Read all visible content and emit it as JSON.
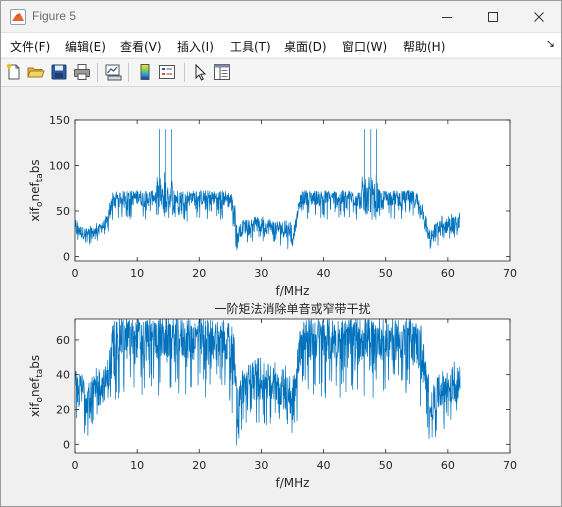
{
  "window": {
    "title": "Figure 5",
    "controls": {
      "minimize": "minimize",
      "maximize": "maximize",
      "close": "close"
    }
  },
  "menu": [
    "文件(F)",
    "编辑(E)",
    "查看(V)",
    "插入(I)",
    "工具(T)",
    "桌面(D)",
    "窗口(W)",
    "帮助(H)"
  ],
  "menu_overflow": "↘",
  "toolbar": [
    "new-figure-icon",
    "open-folder-icon",
    "save-icon",
    "print-icon",
    "link-plot-icon",
    "colorbar-icon",
    "legend-icon",
    "pointer-icon",
    "property-inspector-icon"
  ],
  "colors": {
    "trace": "#0072bd",
    "axes_bg": "#ffffff",
    "figure_bg": "#f0f0f0"
  },
  "chart_data": [
    {
      "type": "line",
      "title": "",
      "xlabel": "f/MHz",
      "ylabel_parts": [
        "xif",
        "o",
        "ne",
        "f",
        "t",
        "a",
        "bs"
      ],
      "xlim": [
        0,
        70
      ],
      "ylim": [
        -5,
        150
      ],
      "xticks": [
        "0",
        "10",
        "20",
        "30",
        "40",
        "50",
        "60",
        "70"
      ],
      "yticks": [
        "0",
        "50",
        "100",
        "150"
      ],
      "xtick_values": [
        0,
        10,
        20,
        30,
        40,
        50,
        60,
        70
      ],
      "ytick_values": [
        0,
        50,
        100,
        150
      ],
      "grid": false,
      "series": [
        {
          "x": [
            0,
            1,
            2,
            3,
            4,
            5,
            5.5,
            6,
            7,
            8,
            9,
            10,
            11,
            12,
            13,
            13.6,
            14,
            14.6,
            15,
            15.5,
            16,
            17,
            18,
            19,
            20,
            21,
            22,
            23,
            24,
            25,
            25.7,
            26.1,
            26.5,
            27,
            28,
            29,
            30,
            31,
            32,
            33,
            34,
            35,
            35.6,
            36,
            36.5,
            37,
            38,
            39,
            40,
            41,
            42,
            43,
            44,
            45,
            46,
            46.6,
            47,
            47.6,
            48,
            48.5,
            49,
            50,
            51,
            52,
            53,
            54,
            55,
            56,
            56.7,
            57.2,
            58,
            59,
            60,
            61,
            62
          ],
          "y_max": [
            42,
            38,
            35,
            36,
            40,
            46,
            58,
            72,
            73,
            72,
            72,
            73,
            72,
            72,
            73,
            140,
            73,
            140,
            73,
            140,
            73,
            72,
            73,
            72,
            72,
            73,
            72,
            72,
            73,
            72,
            62,
            32,
            40,
            45,
            46,
            45,
            46,
            45,
            44,
            44,
            42,
            40,
            45,
            60,
            72,
            73,
            72,
            72,
            73,
            72,
            72,
            73,
            72,
            73,
            73,
            140,
            73,
            140,
            73,
            140,
            72,
            72,
            73,
            72,
            72,
            73,
            72,
            64,
            42,
            30,
            40,
            46,
            47,
            48,
            48
          ],
          "y_min": [
            16,
            12,
            10,
            14,
            18,
            22,
            18,
            35,
            40,
            42,
            40,
            42,
            38,
            40,
            42,
            40,
            42,
            38,
            40,
            42,
            40,
            42,
            38,
            40,
            42,
            40,
            42,
            38,
            40,
            35,
            25,
            -5,
            10,
            14,
            15,
            14,
            15,
            14,
            13,
            12,
            10,
            2,
            22,
            35,
            40,
            42,
            40,
            42,
            38,
            40,
            42,
            40,
            42,
            38,
            40,
            42,
            40,
            42,
            38,
            40,
            42,
            40,
            42,
            38,
            40,
            42,
            35,
            26,
            12,
            4,
            8,
            14,
            16,
            18,
            20
          ],
          "y_mean": [
            30,
            27,
            24,
            26,
            30,
            36,
            42,
            62,
            64,
            65,
            64,
            65,
            64,
            64,
            65,
            65,
            65,
            64,
            65,
            65,
            64,
            65,
            64,
            64,
            65,
            64,
            65,
            64,
            64,
            62,
            50,
            18,
            28,
            32,
            34,
            35,
            34,
            33,
            32,
            31,
            28,
            22,
            36,
            55,
            64,
            65,
            64,
            65,
            64,
            64,
            65,
            64,
            65,
            64,
            64,
            65,
            65,
            64,
            65,
            64,
            64,
            65,
            64,
            64,
            65,
            64,
            62,
            50,
            30,
            20,
            28,
            32,
            34,
            36,
            38
          ]
        }
      ]
    },
    {
      "type": "line",
      "title": "一阶矩法消除单音或窄带干扰",
      "xlabel": "f/MHz",
      "ylabel_parts": [
        "xif",
        "o",
        "ne",
        "f",
        "t",
        "a",
        "bs"
      ],
      "xlim": [
        0,
        70
      ],
      "ylim": [
        -5,
        72
      ],
      "xticks": [
        "0",
        "10",
        "20",
        "30",
        "40",
        "50",
        "60",
        "70"
      ],
      "yticks": [
        "0",
        "20",
        "40",
        "60"
      ],
      "xtick_values": [
        0,
        10,
        20,
        30,
        40,
        50,
        60,
        70
      ],
      "ytick_values": [
        0,
        20,
        40,
        60
      ],
      "grid": false,
      "series": [
        {
          "x": [
            0,
            1,
            2,
            3,
            4,
            5,
            5.5,
            6,
            7,
            8,
            9,
            10,
            11,
            12,
            13,
            14,
            15,
            16,
            17,
            18,
            19,
            20,
            21,
            22,
            23,
            24,
            25,
            25.7,
            26.1,
            26.5,
            27,
            28,
            29,
            30,
            31,
            32,
            33,
            34,
            35,
            35.6,
            36,
            36.5,
            37,
            38,
            39,
            40,
            41,
            42,
            43,
            44,
            45,
            46,
            47,
            48,
            49,
            50,
            51,
            52,
            53,
            54,
            55,
            56,
            56.7,
            57.2,
            58,
            59,
            60,
            61,
            62
          ],
          "y_max": [
            46,
            44,
            42,
            43,
            45,
            50,
            58,
            72,
            72,
            72,
            72,
            72,
            72,
            72,
            72,
            72,
            72,
            72,
            72,
            72,
            72,
            72,
            72,
            72,
            72,
            72,
            72,
            64,
            38,
            42,
            48,
            50,
            51,
            50,
            50,
            49,
            48,
            47,
            44,
            48,
            62,
            72,
            72,
            72,
            72,
            72,
            72,
            72,
            72,
            72,
            72,
            72,
            72,
            72,
            72,
            72,
            72,
            72,
            72,
            72,
            72,
            68,
            46,
            34,
            42,
            46,
            47,
            48,
            48
          ],
          "y_min": [
            10,
            6,
            4,
            6,
            10,
            14,
            8,
            20,
            26,
            28,
            26,
            28,
            25,
            26,
            28,
            26,
            28,
            25,
            26,
            28,
            26,
            28,
            25,
            26,
            28,
            26,
            22,
            12,
            -5,
            4,
            8,
            10,
            9,
            10,
            9,
            8,
            7,
            5,
            -2,
            10,
            20,
            26,
            28,
            26,
            28,
            25,
            26,
            28,
            26,
            28,
            25,
            26,
            28,
            26,
            28,
            25,
            26,
            28,
            26,
            28,
            24,
            16,
            6,
            -1,
            4,
            8,
            10,
            12,
            14
          ],
          "y_mean": [
            32,
            30,
            28,
            29,
            31,
            36,
            40,
            58,
            60,
            61,
            60,
            61,
            60,
            60,
            61,
            60,
            61,
            60,
            60,
            61,
            60,
            61,
            60,
            60,
            61,
            60,
            58,
            46,
            20,
            28,
            33,
            36,
            37,
            36,
            35,
            34,
            33,
            31,
            25,
            34,
            52,
            60,
            61,
            60,
            61,
            60,
            60,
            61,
            60,
            61,
            60,
            60,
            61,
            60,
            61,
            60,
            60,
            61,
            60,
            61,
            58,
            48,
            30,
            18,
            26,
            32,
            33,
            34,
            36
          ]
        }
      ]
    }
  ]
}
